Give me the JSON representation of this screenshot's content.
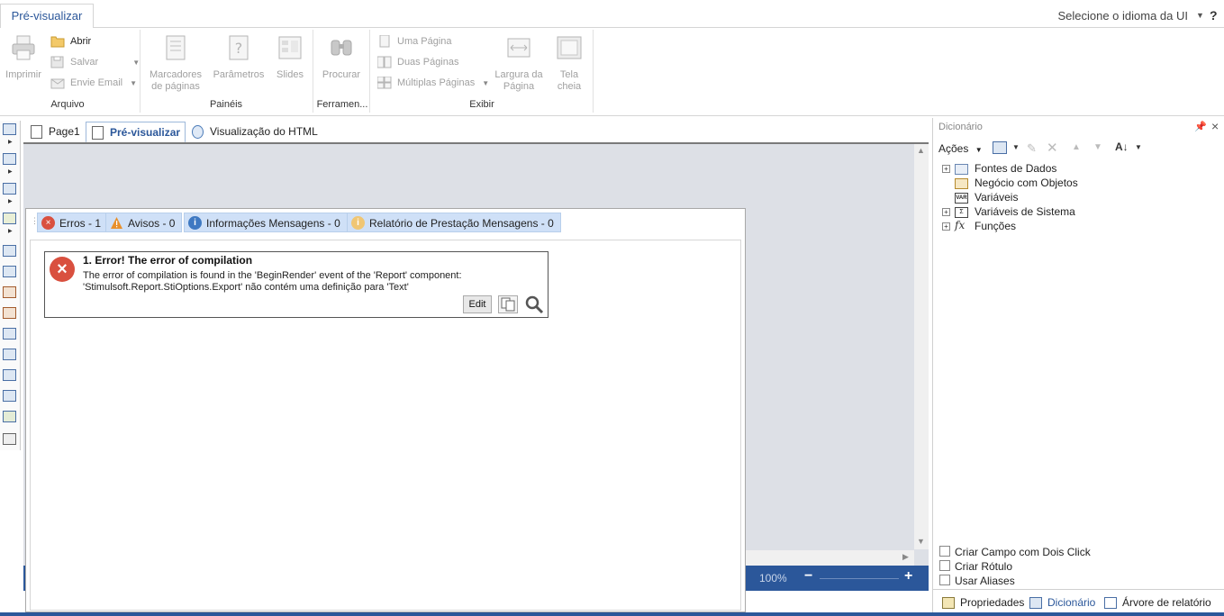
{
  "ribbon_tabs": {
    "preview": "Pré-visualizar"
  },
  "header": {
    "language": "Selecione o idioma da UI",
    "help": "?"
  },
  "ribbon": {
    "print": "Imprimir",
    "open": "Abrir",
    "save": "Salvar",
    "send_email": "Envie Email",
    "group_file": "Arquivo",
    "bookmarks_line1": "Marcadores",
    "bookmarks_line2": "de páginas",
    "parameters": "Parâmetros",
    "slides": "Slides",
    "group_panels": "Painéis",
    "find": "Procurar",
    "group_tools": "Ferramen...",
    "one_page": "Uma Página",
    "two_pages": "Duas Páginas",
    "multiple_pages": "Múltiplas Páginas",
    "page_width_line1": "Largura da",
    "page_width_line2": "Página",
    "fullscreen_line1": "Tela",
    "fullscreen_line2": "cheia",
    "group_view": "Exibir"
  },
  "doc_tabs": {
    "page1": "Page1",
    "preview": "Pré-visualizar",
    "html_preview": "Visualização do HTML"
  },
  "statusbar": {
    "zoom": "100%",
    "zoom_minus": "−",
    "zoom_plus": "+"
  },
  "error_panel": {
    "tabs": {
      "errors": "Erros - 1",
      "warnings": "Avisos - 0",
      "info": "Informações Mensagens - 0",
      "report": "Relatório de Prestação Mensagens - 0"
    },
    "error": {
      "title": "1. Error! The error of compilation",
      "line1": "The error of compilation is found in the 'BeginRender' event of the 'Report' component:",
      "line2": "'Stimulsoft.Report.StiOptions.Export' não contém uma definição para 'Text'",
      "edit": "Edit"
    }
  },
  "dictionary": {
    "title": "Dicionário",
    "actions": "Ações",
    "tree": {
      "data_sources": "Fontes de Dados",
      "business_objects": "Negócio com Objetos",
      "variables": "Variáveis",
      "system_variables": "Variáveis de Sistema",
      "functions": "Funções"
    },
    "options": {
      "dblclick": "Criar Campo com Dois Click",
      "label": "Criar Rótulo",
      "aliases": "Usar Aliases"
    },
    "bottom_tabs": {
      "properties": "Propriedades",
      "dictionary": "Dicionário",
      "report_tree": "Árvore de relatório"
    }
  },
  "colors": {
    "accent": "#2b579a",
    "error": "#d9503f",
    "warning": "#e8902c",
    "info": "#3f79c2",
    "tab_bg": "#cfe0f7"
  }
}
